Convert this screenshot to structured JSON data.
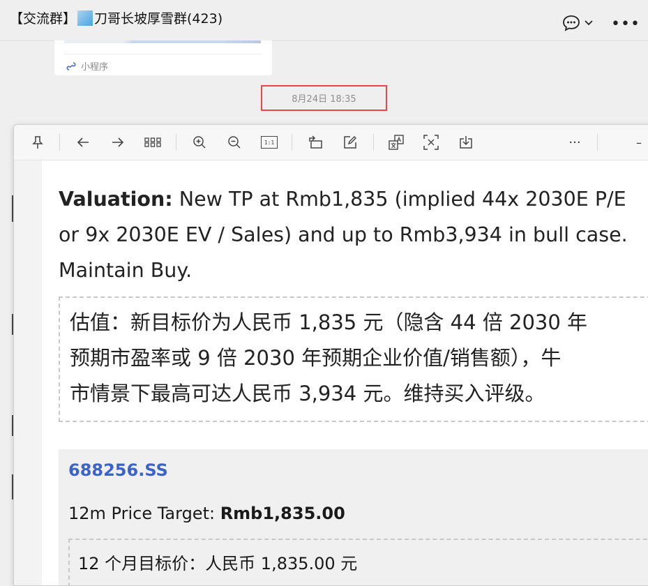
{
  "chat": {
    "title_prefix": "【交流群】",
    "title_suffix": "刀哥长坡厚雪群(423)",
    "more_label": "•••",
    "mini_program_label": "小程序",
    "timestamp": "8月24日 18:35"
  },
  "viewer": {
    "toolbar_icons": [
      "pin-icon",
      "back-arrow-icon",
      "forward-arrow-icon",
      "grid-icon",
      "zoom-in-icon",
      "zoom-out-icon",
      "actual-size-icon",
      "rotate-icon",
      "edit-icon",
      "translate-icon",
      "extract-text-icon",
      "download-icon",
      "more-icon",
      "minimize-icon"
    ],
    "actual_size_label": "1:1",
    "more_label": "···",
    "minimize_label": "–",
    "en_line1_bold": "Valuation:",
    "en_line1_rest": " New TP at Rmb1,835 (implied 44x 2030E P/E",
    "en_line2": "or 9x 2030E EV / Sales) and up to Rmb3,934 in bull case.",
    "en_line3": "Maintain Buy.",
    "cn_line1": "估值：新目标价为人民币 1,835 元（隐含 44 倍 2030 年",
    "cn_line2": "预期市盈率或 9 倍 2030 年预期企业价值/销售额），牛",
    "cn_line3": "市情景下最高可达人民币 3,934 元。维持买入评级。",
    "ticker": "688256.SS",
    "pt_label": "12m Price Target: ",
    "pt_value": "Rmb1,835.00",
    "pt_cn": "12 个月目标价：人民币 1,835.00 元"
  },
  "colors": {
    "highlight_border": "#e8484b",
    "ticker_blue": "#3c63c9"
  }
}
